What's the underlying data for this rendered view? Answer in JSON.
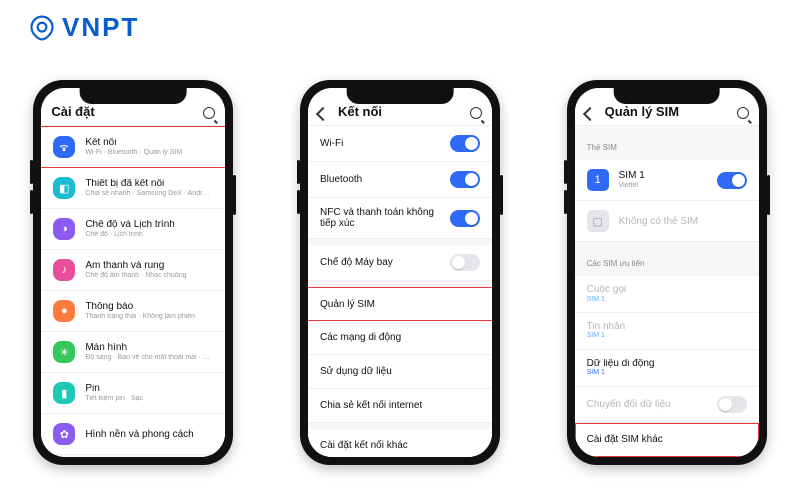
{
  "logo": {
    "text": "VNPT"
  },
  "phone1": {
    "header": "Cài đặt",
    "rows": [
      {
        "title": "Kết nối",
        "sub": "Wi-Fi · Bluetooth · Quản lý SIM"
      },
      {
        "title": "Thiết bị đã kết nối",
        "sub": "Chia sẻ nhanh · Samsung DeX · Android Auto"
      },
      {
        "title": "Chế độ và Lịch trình",
        "sub": "Chế độ · Lịch trình"
      },
      {
        "title": "Âm thanh và rung",
        "sub": "Chế độ âm thanh · Nhạc chuông"
      },
      {
        "title": "Thông báo",
        "sub": "Thanh trạng thái · Không làm phiền"
      },
      {
        "title": "Màn hình",
        "sub": "Độ sáng · Bảo vệ cho mắt thoải mái · Thanh điều hướng"
      },
      {
        "title": "Pin",
        "sub": "Tiết kiệm pin · Sạc"
      },
      {
        "title": "Hình nền và phong cách",
        "sub": ""
      }
    ]
  },
  "phone2": {
    "header": "Kết nối",
    "rows": [
      {
        "title": "Wi-Fi",
        "switch": true
      },
      {
        "title": "Bluetooth",
        "switch": true
      },
      {
        "title": "NFC và thanh toán không tiếp xúc",
        "switch": true
      },
      {
        "title": "Chế độ Máy bay",
        "switch": false
      },
      {
        "title": "Quản lý SIM"
      },
      {
        "title": "Các mạng di động"
      },
      {
        "title": "Sử dụng dữ liệu"
      },
      {
        "title": "Chia sẻ kết nối internet"
      },
      {
        "title": "Cài đặt kết nối khác"
      }
    ]
  },
  "phone3": {
    "header": "Quản lý SIM",
    "section1": "Thẻ SIM",
    "sim1": {
      "title": "SIM 1",
      "sub": "Viettel",
      "switch": true
    },
    "noSim": "Không có thẻ SIM",
    "section2": "Các SIM ưu tiên",
    "pref": {
      "call": {
        "title": "Cuộc gọi",
        "sub": "SIM 1"
      },
      "sms": {
        "title": "Tin nhắn",
        "sub": "SIM 1"
      },
      "data": {
        "title": "Dữ liệu di động",
        "sub": "SIM 1"
      },
      "switch": {
        "title": "Chuyển đổi dữ liệu"
      }
    },
    "other": "Cài đặt SIM khác"
  }
}
